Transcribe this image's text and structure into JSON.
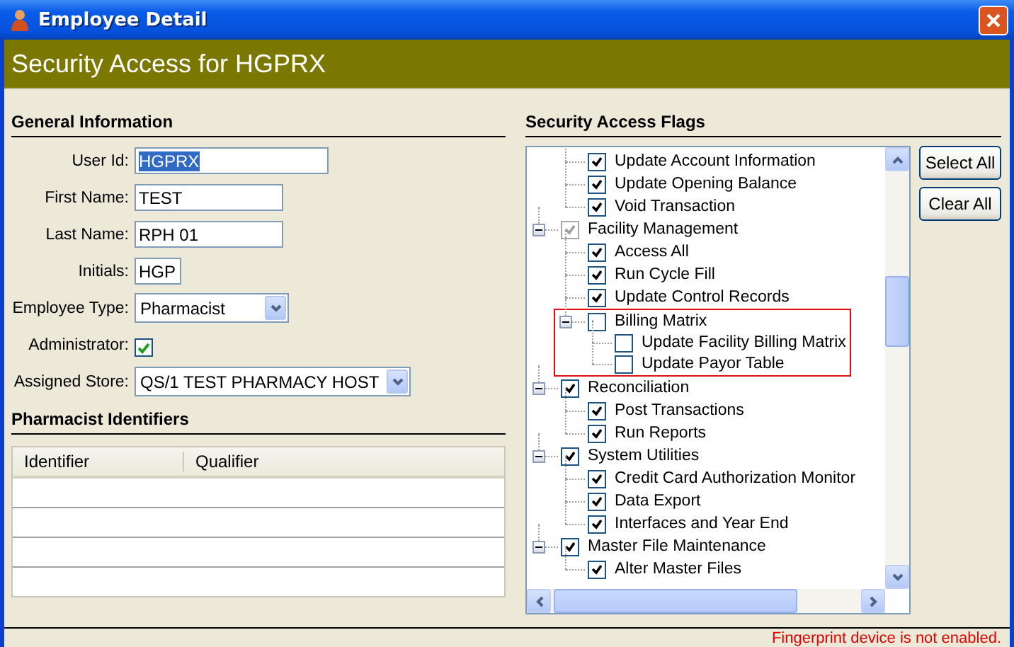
{
  "window": {
    "title": "Employee Detail"
  },
  "header": {
    "title": "Security Access for HGPRX"
  },
  "general": {
    "heading": "General Information",
    "fields": [
      {
        "kind": "text",
        "label": "User Id:",
        "value": "HGPRX",
        "highlighted": true
      },
      {
        "kind": "text",
        "label": "First Name:",
        "value": "TEST",
        "highlighted": false
      },
      {
        "kind": "text",
        "label": "Last Name:",
        "value": "RPH 01",
        "highlighted": false
      },
      {
        "kind": "text",
        "label": "Initials:",
        "value": "HGP",
        "highlighted": false
      },
      {
        "kind": "dropdown",
        "label": "Employee Type:",
        "value": "Pharmacist"
      },
      {
        "kind": "checkbox",
        "label": "Administrator:",
        "checked": true
      },
      {
        "kind": "dropdown",
        "label": "Assigned Store:",
        "value": "QS/1 TEST PHARMACY HOST"
      }
    ]
  },
  "identifiers": {
    "heading": "Pharmacist Identifiers",
    "columns": [
      "Identifier",
      "Qualifier"
    ]
  },
  "flags": {
    "heading": "Security Access Flags",
    "tree": [
      {
        "children": [
          {
            "label": "Update Account Information",
            "checked": true
          },
          {
            "label": "Update Opening Balance",
            "checked": true
          },
          {
            "label": "Void Transaction",
            "checked": true
          }
        ]
      },
      {
        "label": "Facility Management",
        "checked": true,
        "mixed": true,
        "expanded": true,
        "children": [
          {
            "label": "Access All",
            "checked": true
          },
          {
            "label": "Run Cycle Fill",
            "checked": true
          },
          {
            "label": "Update Control Records",
            "checked": true
          },
          {
            "label": "Billing Matrix",
            "checked": false,
            "expanded": true,
            "highlighted": true,
            "children": [
              {
                "label": "Update Facility Billing Matrix",
                "checked": false
              },
              {
                "label": "Update Payor Table",
                "checked": false
              }
            ]
          }
        ]
      },
      {
        "label": "Reconciliation",
        "checked": true,
        "expanded": true,
        "children": [
          {
            "label": "Post Transactions",
            "checked": true
          },
          {
            "label": "Run Reports",
            "checked": true
          }
        ]
      },
      {
        "label": "System Utilities",
        "checked": true,
        "expanded": true,
        "children": [
          {
            "label": "Credit Card Authorization Monitor",
            "checked": true
          },
          {
            "label": "Data Export",
            "checked": true
          },
          {
            "label": "Interfaces and Year End",
            "checked": true
          }
        ]
      },
      {
        "label": "Master File Maintenance",
        "checked": true,
        "expanded": true,
        "children": [
          {
            "label": "Alter Master Files",
            "checked": true
          }
        ]
      }
    ],
    "buttons": [
      "Select All",
      "Clear All"
    ]
  },
  "status_bar": {
    "message": "Fingerprint device is not enabled."
  }
}
